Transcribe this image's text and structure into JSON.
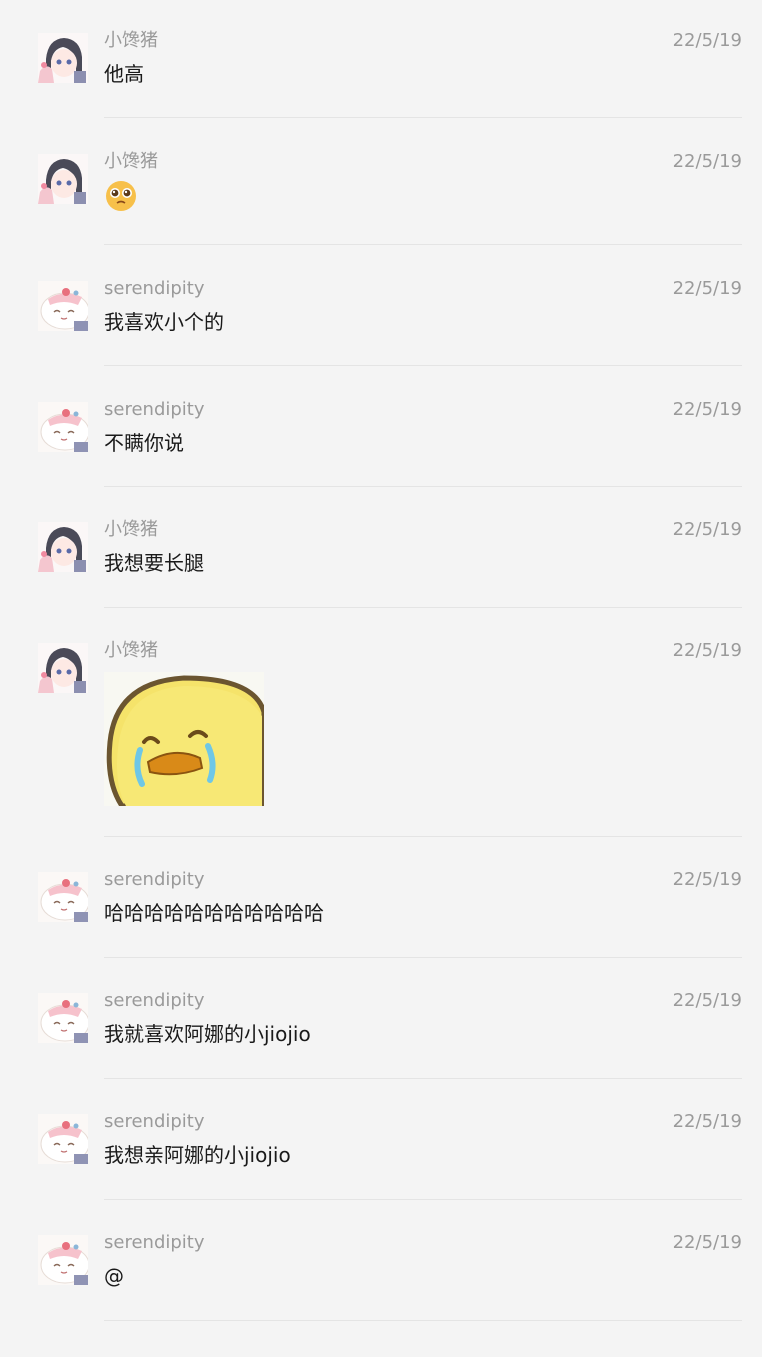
{
  "messages": [
    {
      "sender": "小馋猪",
      "date": "22/5/19",
      "text": "他高",
      "avatar": "girl-avatar"
    },
    {
      "sender": "小馋猪",
      "date": "22/5/19",
      "text": "",
      "avatar": "girl-avatar",
      "emoji": "pleading-face-emoji"
    },
    {
      "sender": "serendipity",
      "date": "22/5/19",
      "text": "我喜欢小个的",
      "avatar": "cat-avatar"
    },
    {
      "sender": "serendipity",
      "date": "22/5/19",
      "text": "不瞒你说",
      "avatar": "cat-avatar"
    },
    {
      "sender": "小馋猪",
      "date": "22/5/19",
      "text": "我想要长腿",
      "avatar": "girl-avatar"
    },
    {
      "sender": "小馋猪",
      "date": "22/5/19",
      "text": "",
      "avatar": "girl-avatar",
      "sticker": "crying-chick-sticker"
    },
    {
      "sender": "serendipity",
      "date": "22/5/19",
      "text": "哈哈哈哈哈哈哈哈哈哈哈",
      "avatar": "cat-avatar"
    },
    {
      "sender": "serendipity",
      "date": "22/5/19",
      "text": "我就喜欢阿娜的小jiojio",
      "avatar": "cat-avatar"
    },
    {
      "sender": "serendipity",
      "date": "22/5/19",
      "text": "我想亲阿娜的小jiojio",
      "avatar": "cat-avatar"
    },
    {
      "sender": "serendipity",
      "date": "22/5/19",
      "text": "@",
      "avatar": "cat-avatar"
    }
  ],
  "colors": {
    "background": "#f4f4f4",
    "meta_text": "#9a9a9a",
    "body_text": "#1a1a1a",
    "divider": "#e4e4e4",
    "sticker_yellow": "#f5e36a"
  }
}
